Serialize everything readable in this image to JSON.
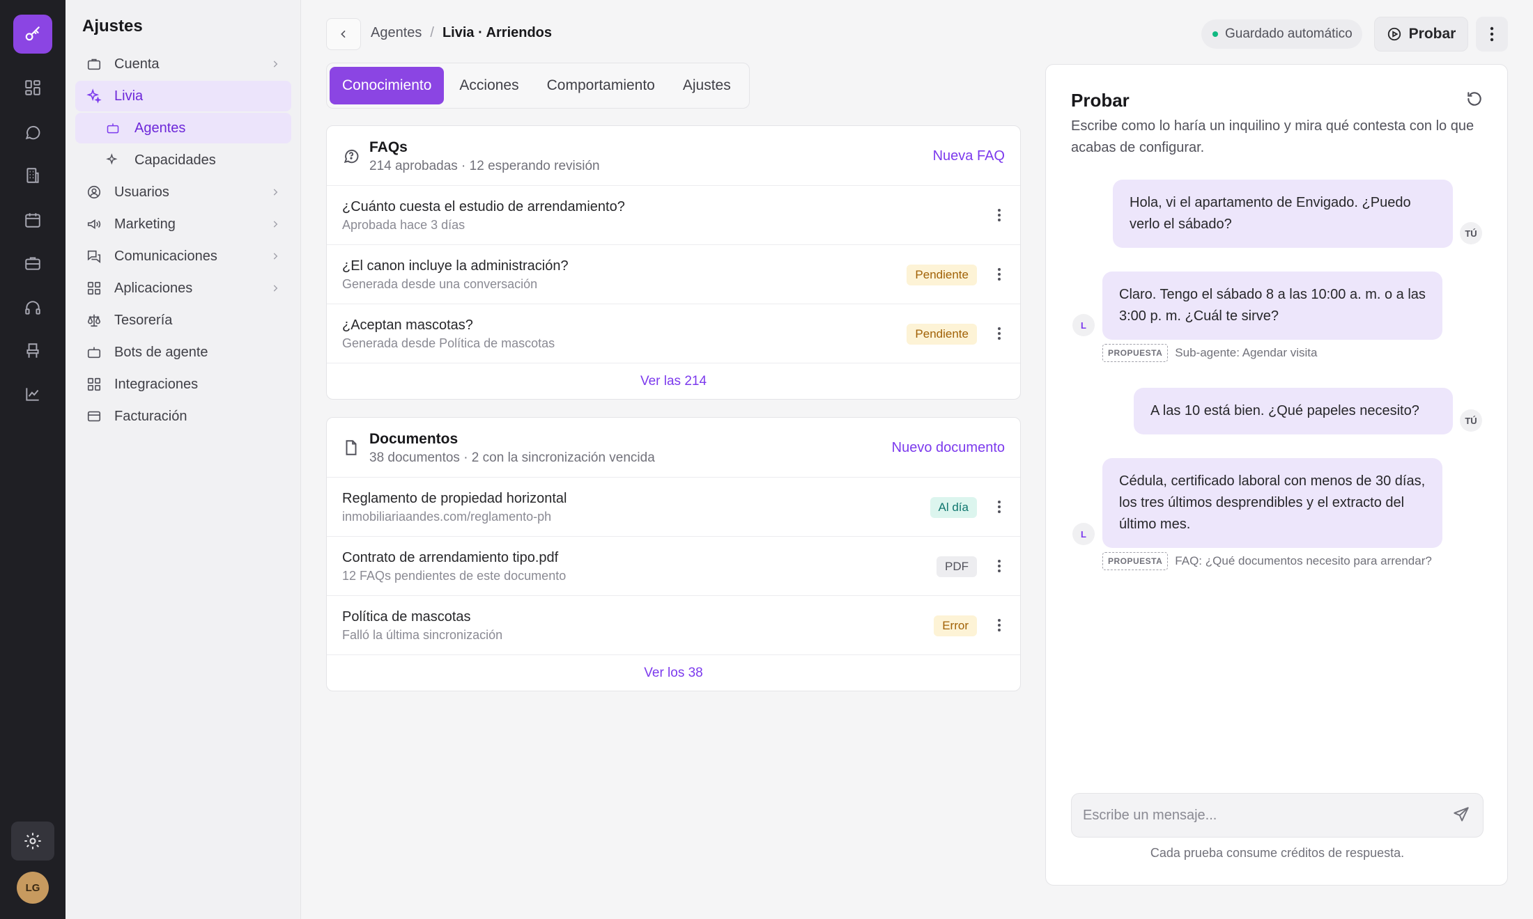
{
  "rail": {
    "logo_icon": "key-icon",
    "icons": [
      "dashboard-icon",
      "chat-icon",
      "building-icon",
      "calendar-icon",
      "briefcase-icon",
      "headset-icon",
      "chair-icon",
      "chart-icon"
    ],
    "avatar": "LG",
    "accent": "#8b45e3"
  },
  "sidebar": {
    "title": "Ajustes",
    "items": [
      {
        "label": "Cuenta"
      },
      {
        "label": "Livia"
      },
      {
        "label": "Agentes"
      },
      {
        "label": "Capacidades"
      },
      {
        "label": "Usuarios"
      },
      {
        "label": "Marketing"
      },
      {
        "label": "Comunicaciones"
      },
      {
        "label": "Aplicaciones"
      },
      {
        "label": "Tesorería"
      },
      {
        "label": "Bots de agente"
      },
      {
        "label": "Integraciones"
      },
      {
        "label": "Facturación"
      }
    ]
  },
  "header": {
    "breadcrumb": [
      "Agentes",
      "/",
      "Livia · Arriendos"
    ],
    "autosave": "Guardado automático",
    "test_button": "Probar"
  },
  "tabs": [
    "Conocimiento",
    "Acciones",
    "Comportamiento",
    "Ajustes"
  ],
  "faqs": {
    "title": "FAQs",
    "subtitle": "214 aprobadas · 12 esperando revisión",
    "action": "Nueva FAQ",
    "rows": [
      {
        "title": "¿Cuánto cuesta el estudio de arrendamiento?",
        "sub": "Aprobada hace 3 días",
        "badge": ""
      },
      {
        "title": "¿El canon incluye la administración?",
        "sub": "Generada desde una conversación",
        "badge": "Pendiente"
      },
      {
        "title": "¿Aceptan mascotas?",
        "sub": "Generada desde Política de mascotas",
        "badge": "Pendiente"
      }
    ],
    "footer": "Ver las 214"
  },
  "documents": {
    "title": "Documentos",
    "subtitle": "38 documentos · 2 con la sincronización vencida",
    "action": "Nuevo documento",
    "rows": [
      {
        "title": "Reglamento de propiedad horizontal",
        "sub": "inmobiliariaandes.com/reglamento-ph",
        "badge": "Al día"
      },
      {
        "title": "Contrato de arrendamiento tipo.pdf",
        "sub": "12 FAQs pendientes de este documento",
        "badge": "PDF"
      },
      {
        "title": "Política de mascotas",
        "sub": "Falló la última sincronización",
        "badge": "Error"
      }
    ],
    "footer": "Ver los 38"
  },
  "test_panel": {
    "title": "Probar",
    "description": "Escribe como lo haría un inquilino y mira qué contesta con lo que acabas de configurar.",
    "messages": [
      {
        "from": "TÚ",
        "text": "Hola, vi el apartamento de Envigado. ¿Puedo verlo el sábado?"
      },
      {
        "from": "L",
        "text": "Claro. Tengo el sábado 8 a las 10:00 a. m. o a las 3:00 p. m. ¿Cuál te sirve?",
        "tag": "PROPUESTA",
        "note": "Sub-agente: Agendar visita"
      },
      {
        "from": "TÚ",
        "text": "A las 10 está bien. ¿Qué papeles necesito?"
      },
      {
        "from": "L",
        "text": "Cédula, certificado laboral con menos de 30 días, los tres últimos desprendibles y el extracto del último mes.",
        "tag": "PROPUESTA",
        "note": "FAQ: ¿Qué documentos necesito para arrendar?"
      }
    ],
    "input_placeholder": "Escribe un mensaje...",
    "footnote": "Cada prueba consume créditos de respuesta."
  }
}
